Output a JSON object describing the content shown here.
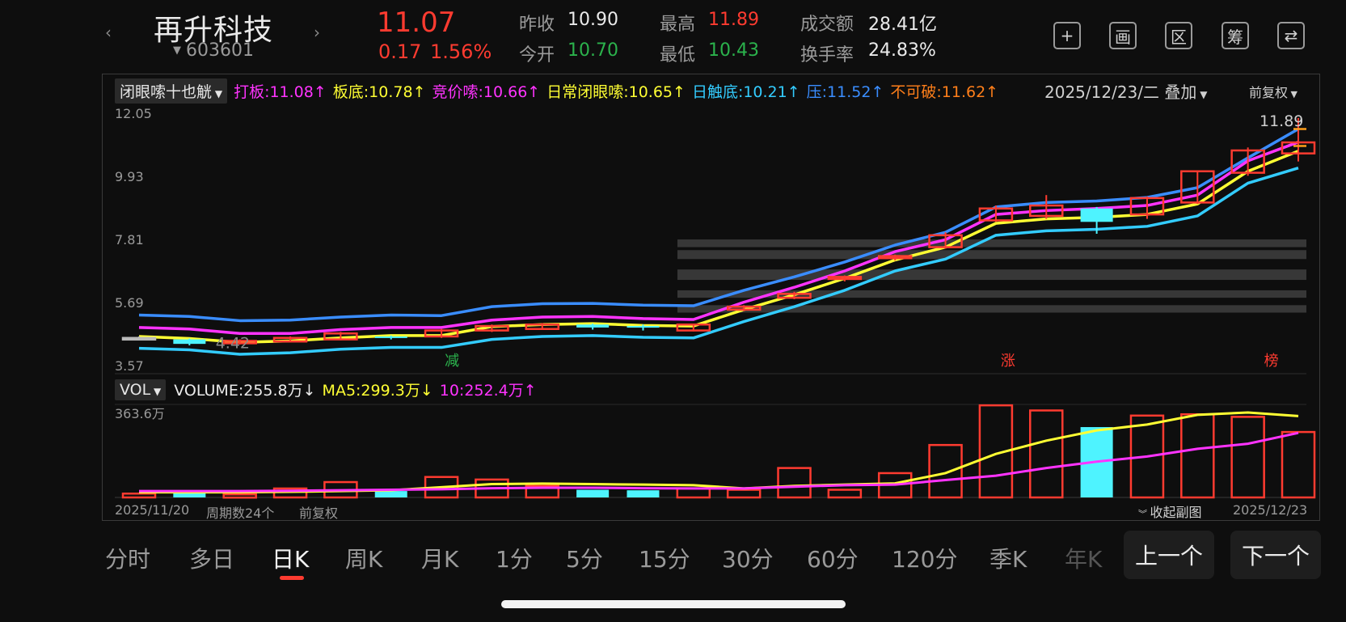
{
  "header": {
    "prev_label": "‹",
    "next_label": "›",
    "stock_name": "再升科技",
    "stock_code": "603601",
    "price": "11.07",
    "change": "0.17",
    "change_pct": "1.56%",
    "quotes": [
      {
        "label": "昨收",
        "value": "10.90",
        "color": "white"
      },
      {
        "label": "今开",
        "value": "10.70",
        "color": "green"
      },
      {
        "label": "最高",
        "value": "11.89",
        "color": "red"
      },
      {
        "label": "最低",
        "value": "10.43",
        "color": "green"
      },
      {
        "label": "成交额",
        "value": "28.41亿",
        "color": "white"
      },
      {
        "label": "换手率",
        "value": "24.83%",
        "color": "white"
      }
    ],
    "tools": [
      {
        "name": "add-icon",
        "glyph": "+"
      },
      {
        "name": "draw-icon",
        "glyph": "画"
      },
      {
        "name": "range-icon",
        "glyph": "区"
      },
      {
        "name": "chips-icon",
        "glyph": "筹"
      },
      {
        "name": "rotate-screen-icon",
        "glyph": "⇄"
      }
    ]
  },
  "indicator_bar": {
    "dropdown": "闭眼嗦十也觥",
    "items": [
      {
        "text": "打板:11.08↑",
        "color": "#ff33ff"
      },
      {
        "text": "板底:10.78↑",
        "color": "#ffff33"
      },
      {
        "text": "竞价嗦:10.66↑",
        "color": "#ff33ff"
      },
      {
        "text": "日常闭眼嗦:10.65↑",
        "color": "#ffff33"
      },
      {
        "text": "日触底:10.21↑",
        "color": "#33ccff"
      },
      {
        "text": "压:11.52↑",
        "color": "#3a8dff"
      },
      {
        "text": "不可破:11.62↑",
        "color": "#ff7f1a"
      }
    ],
    "date_overlay": "2025/12/23/二 叠加",
    "adjust": "前复权"
  },
  "main_chart": {
    "y_ticks": [
      "12.05",
      "9.93",
      "7.81",
      "5.69",
      "3.57"
    ],
    "max_label": "11.89",
    "min_label": "4.42",
    "markers": [
      {
        "text": "减",
        "color": "#2bb24c"
      },
      {
        "text": "涨",
        "color": "#ff3b30"
      },
      {
        "text": "榜",
        "color": "#ff3b30"
      }
    ]
  },
  "volume_bar": {
    "dropdown": "VOL",
    "items": [
      {
        "text": "VOLUME:255.8万↓",
        "color": "#eaeaea"
      },
      {
        "text": "MA5:299.3万↓",
        "color": "#ffff33"
      },
      {
        "text": "10:252.4万↑",
        "color": "#ff33ff"
      }
    ],
    "y_max": "363.6万"
  },
  "footer": {
    "start_date": "2025/11/20",
    "period_count": "周期数24个",
    "adjust": "前复权",
    "collapse": "收起副图",
    "end_date": "2025/12/23"
  },
  "tabs": [
    "分时",
    "多日",
    "日K",
    "周K",
    "月K",
    "1分",
    "5分",
    "15分",
    "30分",
    "60分",
    "120分",
    "季K",
    "年K"
  ],
  "active_tab": "日K",
  "buttons": {
    "prev": "上一个",
    "next": "下一个"
  },
  "chart_data": {
    "type": "candlestick",
    "start_date": "2025/11/20",
    "end_date": "2025/12/23",
    "price_range": [
      3.57,
      12.05
    ],
    "candles": [
      {
        "o": 4.5,
        "c": 4.5,
        "h": 4.55,
        "l": 4.45
      },
      {
        "o": 4.45,
        "c": 4.3,
        "h": 4.48,
        "l": 4.25
      },
      {
        "o": 4.32,
        "c": 4.4,
        "h": 4.45,
        "l": 4.28
      },
      {
        "o": 4.38,
        "c": 4.5,
        "h": 4.55,
        "l": 4.35
      },
      {
        "o": 4.45,
        "c": 4.65,
        "h": 4.7,
        "l": 4.42
      },
      {
        "o": 4.55,
        "c": 4.5,
        "h": 4.58,
        "l": 4.45
      },
      {
        "o": 4.55,
        "c": 4.75,
        "h": 4.8,
        "l": 4.5
      },
      {
        "o": 4.75,
        "c": 4.9,
        "h": 4.95,
        "l": 4.7
      },
      {
        "o": 4.8,
        "c": 4.95,
        "h": 5.0,
        "l": 4.78
      },
      {
        "o": 4.95,
        "c": 4.85,
        "h": 4.98,
        "l": 4.78
      },
      {
        "o": 4.9,
        "c": 4.85,
        "h": 4.95,
        "l": 4.75
      },
      {
        "o": 4.75,
        "c": 4.95,
        "h": 4.98,
        "l": 4.72
      },
      {
        "o": 5.45,
        "c": 5.55,
        "h": 5.6,
        "l": 5.4
      },
      {
        "o": 5.85,
        "c": 5.98,
        "h": 6.05,
        "l": 5.8
      },
      {
        "o": 6.48,
        "c": 6.55,
        "h": 6.6,
        "l": 6.4
      },
      {
        "o": 7.18,
        "c": 7.25,
        "h": 7.3,
        "l": 7.1
      },
      {
        "o": 7.55,
        "c": 7.95,
        "h": 8.05,
        "l": 7.5
      },
      {
        "o": 8.45,
        "c": 8.85,
        "h": 8.95,
        "l": 8.4
      },
      {
        "o": 8.6,
        "c": 8.95,
        "h": 9.3,
        "l": 8.5
      },
      {
        "o": 8.85,
        "c": 8.4,
        "h": 8.9,
        "l": 8.0
      },
      {
        "o": 8.65,
        "c": 9.2,
        "h": 9.25,
        "l": 8.5
      },
      {
        "o": 9.05,
        "c": 10.1,
        "h": 10.1,
        "l": 9.0
      },
      {
        "o": 10.05,
        "c": 10.8,
        "h": 10.9,
        "l": 9.95
      },
      {
        "o": 10.7,
        "c": 11.07,
        "h": 11.89,
        "l": 10.43
      }
    ],
    "series": [
      {
        "name": "压",
        "color": "#3a8dff",
        "values": [
          5.27,
          5.22,
          5.08,
          5.1,
          5.2,
          5.27,
          5.25,
          5.55,
          5.65,
          5.66,
          5.6,
          5.58,
          6.1,
          6.55,
          7.05,
          7.62,
          8.05,
          8.9,
          9.05,
          9.1,
          9.22,
          9.55,
          10.55,
          11.52
        ]
      },
      {
        "name": "打板",
        "color": "#ff33ff",
        "values": [
          4.85,
          4.8,
          4.65,
          4.65,
          4.78,
          4.85,
          4.85,
          5.1,
          5.2,
          5.22,
          5.15,
          5.12,
          5.7,
          6.2,
          6.75,
          7.4,
          7.8,
          8.65,
          8.78,
          8.85,
          8.95,
          9.3,
          10.45,
          11.08
        ]
      },
      {
        "name": "板底",
        "color": "#ffff33",
        "values": [
          4.55,
          4.48,
          4.35,
          4.4,
          4.5,
          4.58,
          4.58,
          4.88,
          4.95,
          4.98,
          4.92,
          4.9,
          5.45,
          5.95,
          6.5,
          7.12,
          7.55,
          8.35,
          8.5,
          8.55,
          8.65,
          9.0,
          10.1,
          10.78
        ]
      },
      {
        "name": "日触底",
        "color": "#33ccff",
        "values": [
          4.15,
          4.1,
          3.95,
          4.0,
          4.12,
          4.18,
          4.18,
          4.45,
          4.55,
          4.58,
          4.52,
          4.5,
          5.05,
          5.55,
          6.1,
          6.75,
          7.15,
          7.95,
          8.1,
          8.15,
          8.25,
          8.6,
          9.7,
          10.21
        ]
      }
    ],
    "volume": {
      "unit": "万",
      "y_max": 363.6,
      "values": [
        15,
        18,
        12,
        35,
        60,
        25,
        80,
        70,
        45,
        30,
        28,
        35,
        30,
        115,
        30,
        95,
        205,
        360,
        340,
        275,
        320,
        325,
        315,
        255.8
      ],
      "ma5": [
        20,
        20,
        20,
        22,
        25,
        28,
        40,
        52,
        54,
        52,
        50,
        48,
        35,
        45,
        50,
        55,
        95,
        170,
        222,
        262,
        285,
        323,
        332,
        318
      ],
      "ma10": [
        25,
        25,
        25,
        26,
        28,
        30,
        32,
        36,
        38,
        38,
        36,
        35,
        35,
        42,
        48,
        50,
        68,
        85,
        115,
        140,
        160,
        190,
        210,
        252.4
      ]
    }
  }
}
